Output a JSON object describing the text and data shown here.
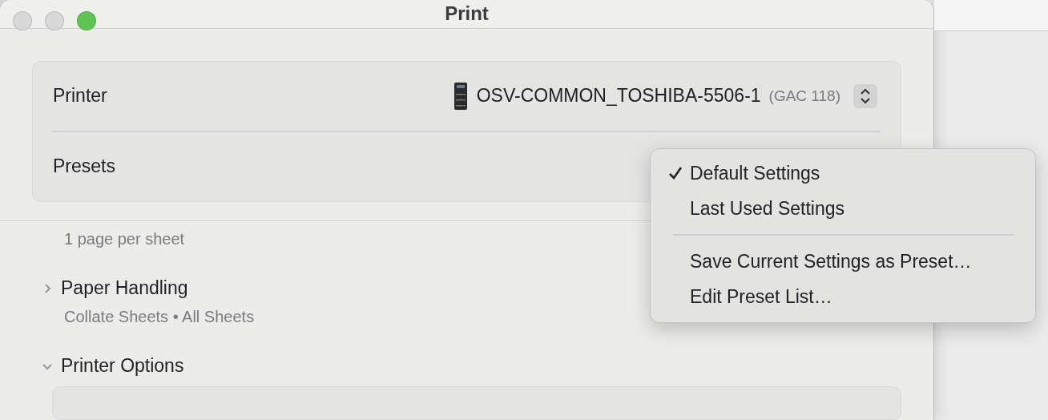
{
  "window": {
    "title": "Print"
  },
  "printer": {
    "label": "Printer",
    "name": "OSV-COMMON_TOSHIBA-5506-1",
    "location": "(GAC 118)"
  },
  "presets": {
    "label": "Presets"
  },
  "layout_summary": "1 page per sheet",
  "sections": [
    {
      "title": "Paper Handling",
      "summary": "Collate Sheets • All Sheets",
      "expanded": false
    },
    {
      "title": "Printer Options",
      "expanded": true
    }
  ],
  "presets_menu": {
    "items": [
      {
        "kind": "option",
        "label": "Default Settings",
        "selected": true
      },
      {
        "kind": "option",
        "label": "Last Used Settings",
        "selected": false
      },
      {
        "kind": "separator"
      },
      {
        "kind": "action",
        "label": "Save Current Settings as Preset…"
      },
      {
        "kind": "action",
        "label": "Edit Preset List…"
      }
    ]
  }
}
